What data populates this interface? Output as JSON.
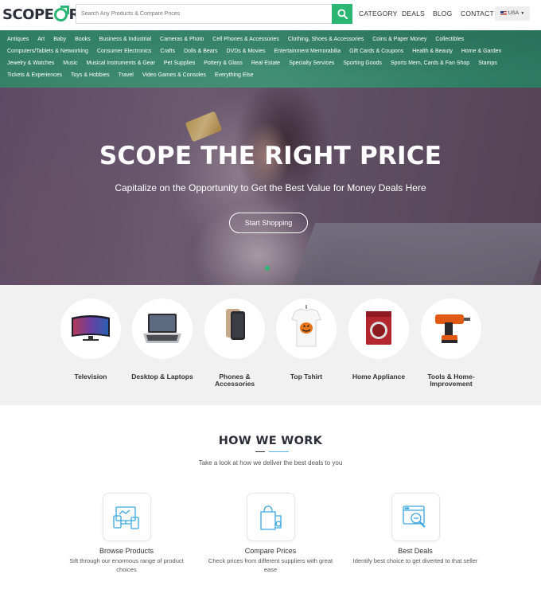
{
  "header": {
    "logo_left": "SCOPE",
    "logo_right": "RICE",
    "search_placeholder": "Search Any Products & Compare Prices",
    "nav": [
      "CATEGORY",
      "DEALS",
      "BLOG",
      "CONTACT"
    ],
    "country": "USA"
  },
  "categories_bar": {
    "rows": [
      [
        "Antiques",
        "Art",
        "Baby",
        "Books",
        "Business & Industrial",
        "Cameras & Photo",
        "Cell Phones & Accessories",
        "Clothing, Shoes & Accessories",
        "Coins & Paper Money",
        "Collectibles"
      ],
      [
        "Computers/Tablets & Networking",
        "Consumer Electronics",
        "Crafts",
        "Dolls & Bears",
        "DVDs & Movies",
        "Entertainment Memorabilia",
        "Gift Cards & Coupons",
        "Health & Beauty",
        "Home & Garden"
      ],
      [
        "Jewelry & Watches",
        "Music",
        "Musical Instruments & Gear",
        "Pet Supplies",
        "Pottery & Glass",
        "Real Estate",
        "Specialty Services",
        "Sporting Goods",
        "Sports Mem, Cards & Fan Shop",
        "Stamps"
      ],
      [
        "Tickets & Experiences",
        "Toys & Hobbies",
        "Travel",
        "Video Games & Consoles",
        "Everything Else"
      ]
    ]
  },
  "hero": {
    "title": "SCOPE THE RIGHT PRICE",
    "subtitle": "Capitalize on the Opportunity to Get the Best Value for Money Deals Here",
    "button": "Start Shopping"
  },
  "featured_categories": [
    {
      "label": "Television",
      "icon": "television-image"
    },
    {
      "label": "Desktop & Laptops",
      "icon": "laptop-image"
    },
    {
      "label": "Phones & Accessories",
      "icon": "phone-image"
    },
    {
      "label": "Top Tshirt",
      "icon": "tshirt-image"
    },
    {
      "label": "Home Appliance",
      "icon": "washing-machine-image"
    },
    {
      "label": "Tools & Home-Improvement",
      "icon": "drill-image"
    }
  ],
  "how_we_work": {
    "title": "HOW WE WORK",
    "subtitle": "Take a look at how we deliver the best deals to you",
    "steps": [
      {
        "title": "Browse Products",
        "desc": "Sift through our enormous range of product choices",
        "icon": "devices-icon"
      },
      {
        "title": "Compare Prices",
        "desc": "Check prices from different suppliers with great ease",
        "icon": "shopping-bag-icon"
      },
      {
        "title": "Best Deals",
        "desc": "Identify best choice to get diverted to that seller",
        "icon": "deal-search-icon"
      }
    ]
  },
  "colors": {
    "accent": "#2bb673",
    "category_band": "#3a8a6f",
    "title_dark": "#2b2f3a",
    "line_blue": "#5ab4e8"
  }
}
